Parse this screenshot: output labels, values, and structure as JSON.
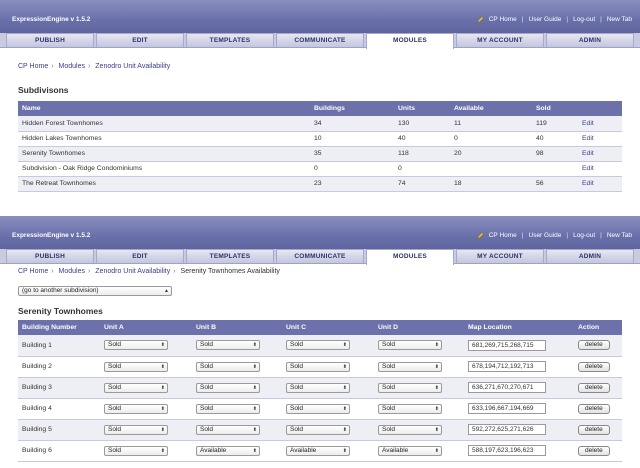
{
  "app": {
    "title": "ExpressionEngine  v 1.5.2",
    "header_links": [
      "CP Home",
      "User Guide",
      "Log-out",
      "New Tab"
    ],
    "nav_tabs": [
      "PUBLISH",
      "EDIT",
      "TEMPLATES",
      "COMMUNICATE",
      "MODULES",
      "MY ACCOUNT",
      "ADMIN"
    ],
    "active_tab": "MODULES"
  },
  "screen1": {
    "breadcrumb": [
      "CP Home",
      "Modules",
      "Zenodro Unit Availability"
    ],
    "heading": "Subdivisons",
    "columns": [
      "Name",
      "Buildings",
      "Units",
      "Available",
      "Sold",
      ""
    ],
    "rows": [
      {
        "name": "Hidden Forest Townhomes",
        "buildings": "34",
        "units": "130",
        "available": "11",
        "sold": "119",
        "action": "Edit"
      },
      {
        "name": "Hidden Lakes Townhomes",
        "buildings": "10",
        "units": "40",
        "available": "0",
        "sold": "40",
        "action": "Edit"
      },
      {
        "name": "Serenity Townhomes",
        "buildings": "35",
        "units": "118",
        "available": "20",
        "sold": "98",
        "action": "Edit"
      },
      {
        "name": "Subdivision - Oak Ridge Condominiums",
        "buildings": "0",
        "units": "0",
        "available": "",
        "sold": "",
        "action": "Edit"
      },
      {
        "name": "The Retreat Townhomes",
        "buildings": "23",
        "units": "74",
        "available": "18",
        "sold": "56",
        "action": "Edit"
      }
    ]
  },
  "screen2": {
    "breadcrumb": [
      "CP Home",
      "Modules",
      "Zenodro Unit Availability",
      "Serenity Townhomes Availability"
    ],
    "subdivision_select": "(go to another subdivision)",
    "heading": "Serenity Townhomes",
    "columns": [
      "Building Number",
      "Unit A",
      "Unit B",
      "Unit C",
      "Unit D",
      "Map Location",
      "Action"
    ],
    "rows": [
      {
        "building": "Building 1",
        "a": "Sold",
        "b": "Sold",
        "c": "Sold",
        "d": "Sold",
        "map": "681,269,715,268,715",
        "action": "delete"
      },
      {
        "building": "Building 2",
        "a": "Sold",
        "b": "Sold",
        "c": "Sold",
        "d": "Sold",
        "map": "678,194,712,192,713",
        "action": "delete"
      },
      {
        "building": "Building 3",
        "a": "Sold",
        "b": "Sold",
        "c": "Sold",
        "d": "Sold",
        "map": "636,271,670,270,671",
        "action": "delete"
      },
      {
        "building": "Building 4",
        "a": "Sold",
        "b": "Sold",
        "c": "Sold",
        "d": "Sold",
        "map": "633,196,667,194,669",
        "action": "delete"
      },
      {
        "building": "Building 5",
        "a": "Sold",
        "b": "Sold",
        "c": "Sold",
        "d": "Sold",
        "map": "592,272,625,271,626",
        "action": "delete"
      },
      {
        "building": "Building 6",
        "a": "Sold",
        "b": "Available",
        "c": "Available",
        "d": "Available",
        "map": "588,197,623,196,623",
        "action": "delete"
      }
    ]
  },
  "icons": {
    "cp_home": "pencil-icon",
    "select_arrow": "updown-arrow-icon"
  },
  "colors": {
    "header": "#6a70aa",
    "table_header": "#6c70ab",
    "link": "#3a3e8c",
    "row_alt": "#eeeef5"
  }
}
